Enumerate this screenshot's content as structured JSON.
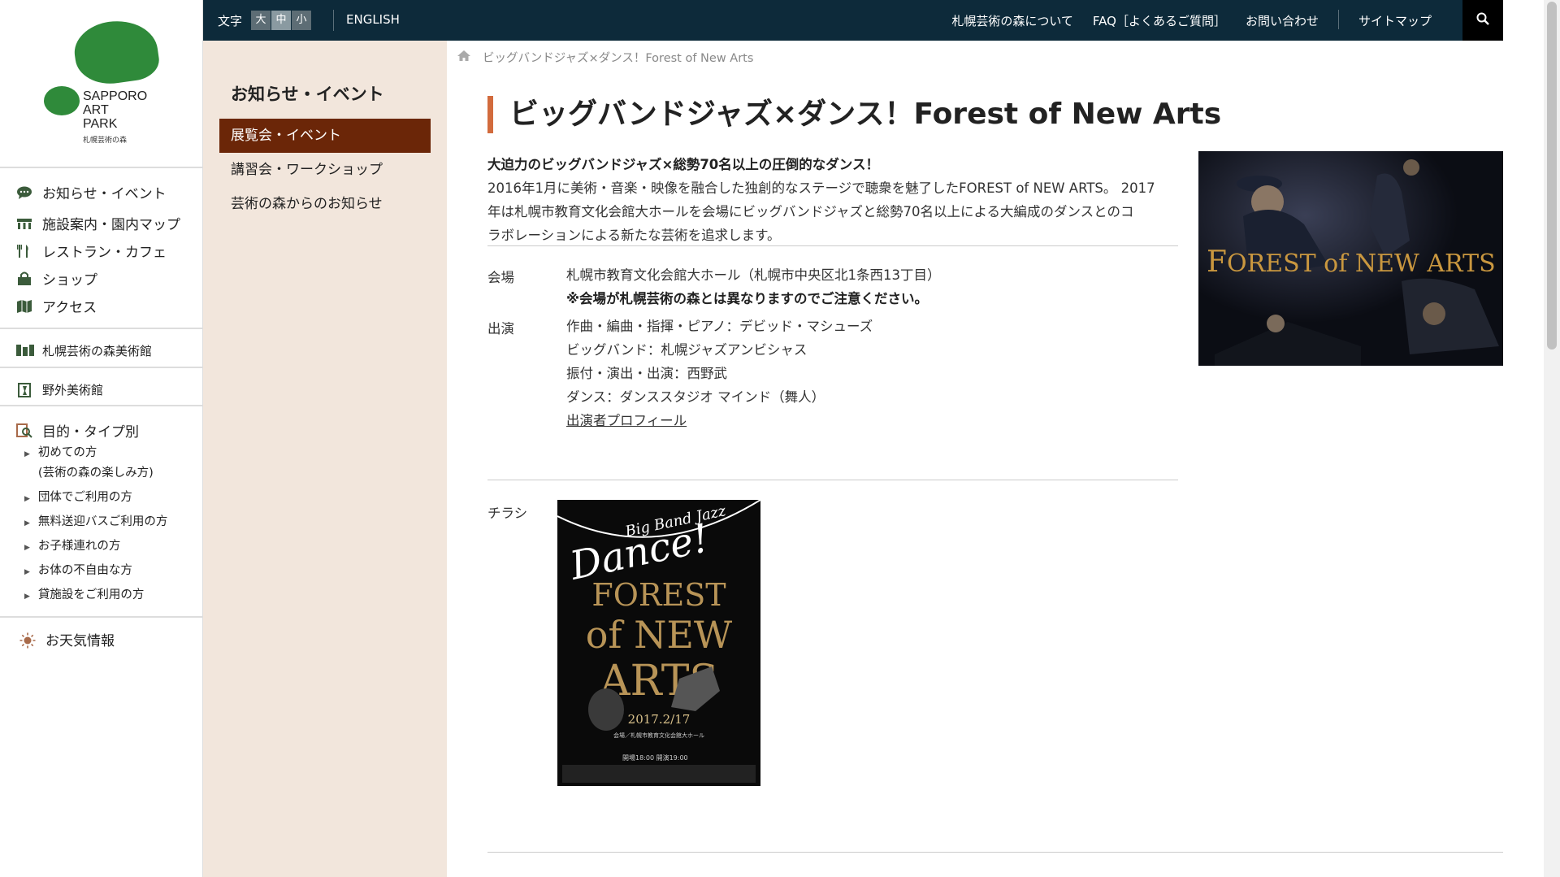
{
  "logo": {
    "brand_lines": [
      "SAPPORO",
      "ART",
      "PARK"
    ],
    "sub": "札幌芸術の森"
  },
  "sidebar": {
    "main_items": [
      {
        "label": "お知らせ・イベント",
        "icon": "speech-bubble-icon"
      },
      {
        "label": "施設案内・園内マップ",
        "icon": "building-icon"
      },
      {
        "label": "レストラン・カフェ",
        "icon": "fork-knife-icon"
      },
      {
        "label": "ショップ",
        "icon": "shopping-bag-icon"
      },
      {
        "label": "アクセス",
        "icon": "map-icon"
      }
    ],
    "museum": "札幌芸術の森美術館",
    "outdoor": "野外美術館",
    "purpose": {
      "title": "目的・タイプ別",
      "items": [
        {
          "line1": "初めての方",
          "line2": "(芸術の森の楽しみ方)"
        },
        {
          "line1": "団体でご利用の方"
        },
        {
          "line1": "無料送迎バスご利用の方"
        },
        {
          "line1": "お子様連れの方"
        },
        {
          "line1": "お体の不自由な方"
        },
        {
          "line1": "貸施設をご利用の方"
        }
      ]
    },
    "weather": "お天気情報"
  },
  "topbar": {
    "font_size_label": "文字",
    "font_sizes": [
      "大",
      "中",
      "小"
    ],
    "english": "ENGLISH",
    "nav": [
      "札幌芸術の森について",
      "FAQ［よくあるご質問］",
      "お問い合わせ",
      "サイトマップ"
    ],
    "search_icon": "magnifier-icon"
  },
  "subnav": {
    "title": "お知らせ・イベント",
    "items": [
      "展覧会・イベント",
      "講習会・ワークショップ",
      "芸術の森からのお知らせ"
    ]
  },
  "breadcrumb": {
    "home_icon": "home-icon",
    "current": "ビッグバンドジャズ×ダンス！Forest of New Arts"
  },
  "article": {
    "title": "ビッグバンドジャズ×ダンス！Forest of New Arts",
    "lead": "大迫力のビッグバンドジャズ×総勢70名以上の圧倒的なダンス！",
    "intro_lines": [
      "2016年1月に美術・音楽・映像を融合した独創的なステージで聴衆を魅了したFOREST of NEW ARTS。 2017",
      "年は札幌市教育文化会館大ホールを会場にビッグバンドジャズと総勢70名以上による大編成のダンスとのコ",
      "ラボレーションによる新たな芸術を追求します。"
    ],
    "venue_label": "会場",
    "venue": "札幌市教育文化会館大ホール（札幌市中央区北1条西13丁目）",
    "venue_warning": "※会場が札幌芸術の森とは異なりますのでご注意ください。",
    "cast_label": "出演",
    "cast": [
      "作曲・編曲・指揮・ピアノ：デビッド・マシューズ",
      "ビッグバンド：札幌ジャズアンビシャス",
      "振付・演出・出演：西野武",
      "ダンス：ダンススタジオ マインド（舞人）"
    ],
    "cast_link": "出演者プロフィール",
    "flyer_label": "チラシ"
  },
  "hero_image": {
    "text_pre": "F",
    "text_main": "OREST of NEW ARTS"
  },
  "flyer": {
    "script_top": "Big Band Jazz",
    "script_dance": "Dance!",
    "line1": "FOREST",
    "line2": "of NEW",
    "line3": "ARTS",
    "date": "2017.2/17",
    "venue": "会場／札幌市教育文化会館大ホール",
    "times": "開場18:00 開演19:00"
  },
  "colors": {
    "topbar": "#0d2a3a",
    "subnav_bg": "#f2e6dc",
    "subnav_active": "#6b2608",
    "title_accent": "#d26b3d",
    "logo_green": "#2f8a3a"
  }
}
